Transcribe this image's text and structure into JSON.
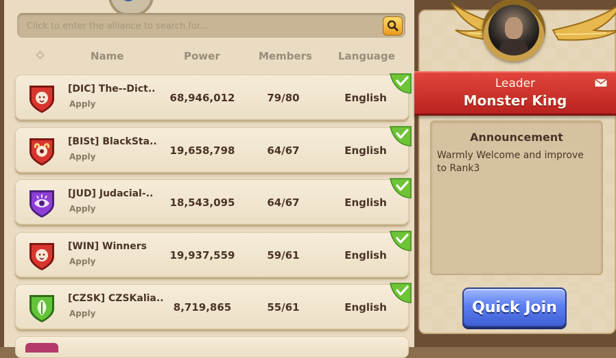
{
  "search": {
    "placeholder": "Click to enter the alliance to search for..."
  },
  "columns": {
    "name": "Name",
    "power": "Power",
    "members": "Members",
    "language": "Language"
  },
  "alliances": [
    {
      "name": "[DIC] The--Dict..",
      "apply": "Apply",
      "power": "68,946,012",
      "members": "79/80",
      "language": "English",
      "emblem": "lion-shield-icon",
      "emblem_color": "#d9352f"
    },
    {
      "name": "[BISt] BlackSta..",
      "apply": "Apply",
      "power": "19,658,798",
      "members": "64/67",
      "language": "English",
      "emblem": "ram-shield-icon",
      "emblem_color": "#d9352f"
    },
    {
      "name": "[JUD] Judacial-..",
      "apply": "Apply",
      "power": "18,543,095",
      "members": "64/67",
      "language": "English",
      "emblem": "eye-shield-icon",
      "emblem_color": "#8e3fd6"
    },
    {
      "name": "[WIN] Winners",
      "apply": "Apply",
      "power": "19,937,559",
      "members": "59/61",
      "language": "English",
      "emblem": "lion-shield-icon",
      "emblem_color": "#d9352f"
    },
    {
      "name": "[CZSK] CZSKalia..",
      "apply": "Apply",
      "power": "8,719,865",
      "members": "55/61",
      "language": "English",
      "emblem": "leaf-shield-icon",
      "emblem_color": "#63c43a"
    }
  ],
  "leader": {
    "title": "Leader",
    "name": "Monster King"
  },
  "announcement": {
    "title": "Announcement",
    "text": "Warmly Welcome and improve to Rank3"
  },
  "quick_join": "Quick Join",
  "colors": {
    "banner_red": "#d23a32",
    "check_green": "#6ec337",
    "button_blue": "#5c7ff0",
    "panel_beige": "#e9dcc3"
  }
}
